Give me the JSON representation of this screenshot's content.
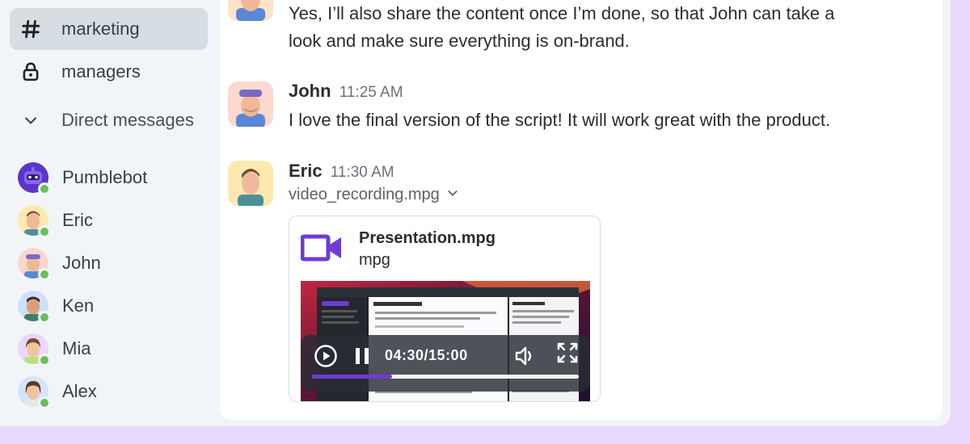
{
  "sidebar": {
    "channels": [
      {
        "name": "marketing",
        "icon": "hash-icon",
        "active": true
      },
      {
        "name": "managers",
        "icon": "lock-icon",
        "active": false
      }
    ],
    "dm_header": "Direct messages",
    "dms": [
      {
        "name": "Pumblebot",
        "online": true
      },
      {
        "name": "Eric",
        "online": true
      },
      {
        "name": "John",
        "online": true
      },
      {
        "name": "Ken",
        "online": true
      },
      {
        "name": "Mia",
        "online": true
      },
      {
        "name": "Alex",
        "online": true
      }
    ]
  },
  "messages": [
    {
      "text_lines": [
        "Yes, I’ll also share the content once I’m done, so that John can take a",
        "look and make sure everything is on-brand."
      ]
    },
    {
      "author": "John",
      "time": "11:25 AM",
      "text": "I love the final version of the script! It will work great with the product."
    },
    {
      "author": "Eric",
      "time": "11:30 AM",
      "file_name": "video_recording.mpg"
    }
  ],
  "attachment": {
    "title": "Presentation.mpg",
    "type": "mpg",
    "player": {
      "time": "04:30/15:00",
      "progress": 0.3
    }
  },
  "colors": {
    "accent": "#6e3bd6",
    "online": "#67c05b",
    "active_bg": "#d6dde3",
    "frame_bg": "#e6d9fb"
  }
}
